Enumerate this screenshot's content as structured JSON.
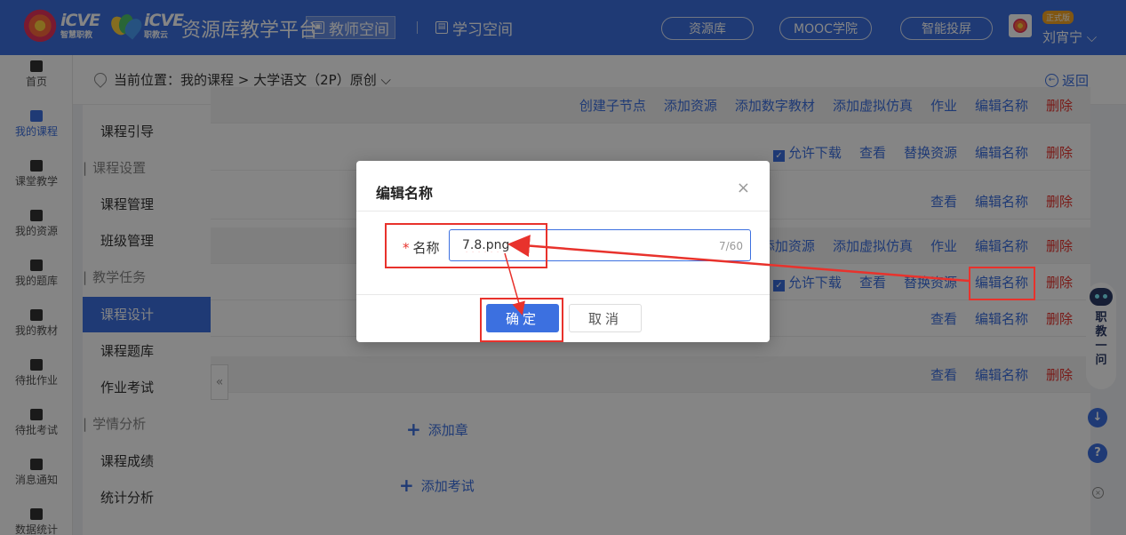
{
  "header": {
    "brand1": "iCVE",
    "brand1_sub": "智慧职教",
    "brand2": "iCVE",
    "brand2_sub": "职教云",
    "platform_title": "资源库教学平台",
    "teacher_space": "教师空间",
    "student_space": "学习空间",
    "resource_lib": "资源库",
    "mooc": "MOOC学院",
    "smart_cast": "智能投屏",
    "edition": "正式版",
    "username": "刘宵宁 ⌵"
  },
  "leftnav": [
    {
      "label": "首页",
      "icon": "home-icon"
    },
    {
      "label": "我的课程",
      "icon": "courses-icon"
    },
    {
      "label": "课堂教学",
      "icon": "classroom-icon"
    },
    {
      "label": "我的资源",
      "icon": "resources-icon"
    },
    {
      "label": "我的题库",
      "icon": "question-bank-icon"
    },
    {
      "label": "我的教材",
      "icon": "textbook-icon"
    },
    {
      "label": "待批作业",
      "icon": "homework-icon"
    },
    {
      "label": "待批考试",
      "icon": "exam-icon"
    },
    {
      "label": "消息通知",
      "icon": "message-icon"
    },
    {
      "label": "数据统计",
      "icon": "stats-icon"
    }
  ],
  "breadcrumb": {
    "text": "当前位置：我的课程 > 大学语文（2P）原创 ⌵",
    "back": "返回"
  },
  "submenu": {
    "course_guide": "课程引导",
    "group_settings": "课程设置",
    "course_manage": "课程管理",
    "class_manage": "班级管理",
    "group_tasks": "教学任务",
    "course_design": "课程设计",
    "course_bank": "课程题库",
    "homework_exam": "作业考试",
    "group_analysis": "学情分析",
    "course_grades": "课程成绩",
    "stat_analysis": "统计分析"
  },
  "actions": {
    "create_child": "创建子节点",
    "add_resource": "添加资源",
    "add_digital": "添加数字教材",
    "add_sim": "添加虚拟仿真",
    "homework": "作业",
    "edit_name": "编辑名称",
    "delete": "删除",
    "allow_download": "允许下载",
    "view": "查看",
    "replace": "替换资源",
    "add_chapter": "添加章",
    "add_exam": "添加考试"
  },
  "dialog": {
    "title": "编辑名称",
    "label": "名称",
    "required_mark": "*",
    "value": "7.8.png",
    "count": "7/60",
    "ok": "确定",
    "cancel": "取消"
  },
  "floating": {
    "assistant": "职教一问"
  },
  "colors": {
    "primary": "#3c70e0",
    "danger": "#e8322c",
    "annotation": "#e8322c"
  }
}
